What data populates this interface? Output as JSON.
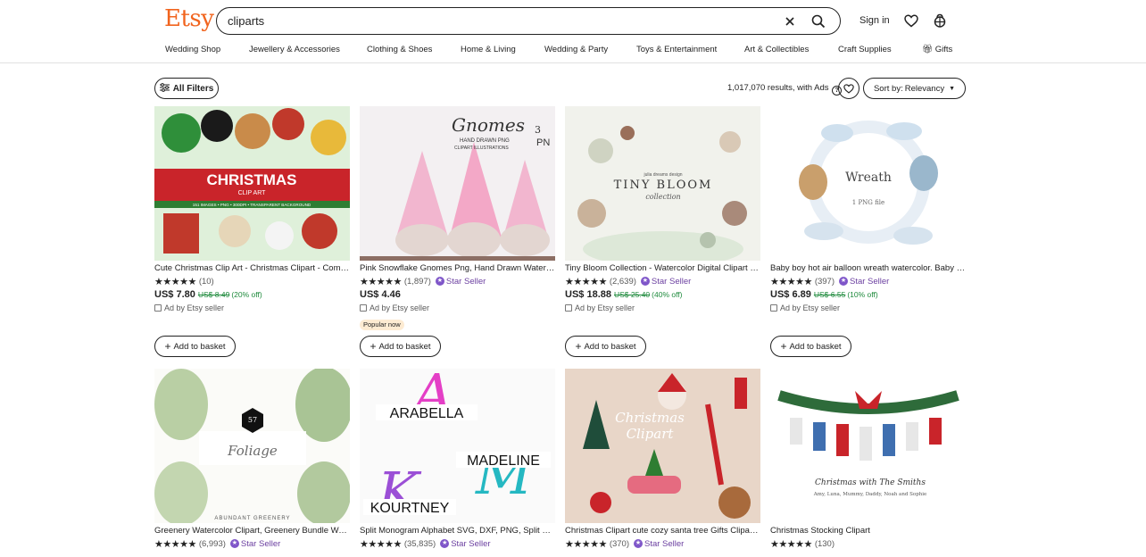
{
  "header": {
    "logo": "Etsy",
    "search_value": "cliparts",
    "signin_label": "Sign in",
    "icons": [
      "close-icon",
      "search-icon",
      "heart-icon",
      "basket-icon"
    ]
  },
  "nav": {
    "items": [
      "Wedding Shop",
      "Jewellery & Accessories",
      "Clothing & Shoes",
      "Home & Living",
      "Wedding & Party",
      "Toys & Entertainment",
      "Art & Collectibles",
      "Craft Supplies",
      "Gifts"
    ]
  },
  "toolbar": {
    "filters_label": "All Filters",
    "results_text": "1,017,070 results, with Ads",
    "sort_prefix": "Sort by:",
    "sort_value": "Relevancy"
  },
  "listings": [
    {
      "title": "Cute Christmas Clip Art - Christmas Clipart - Commercial Use - Digital Download",
      "image_text": [
        "CHRISTMAS",
        "CLIP ART",
        "151 IMAGES • PNG • 300DPI • TRANSPARENT BACKGROUND"
      ],
      "reviews": "(10)",
      "star_seller": "",
      "price": "US$ 7.80",
      "was": "US$ 8.49",
      "off": "(20% off)",
      "ad": "Ad by Etsy seller",
      "badge": "",
      "basket_label": "Add to basket"
    },
    {
      "title": "Pink Snowflake Gnomes Png, Hand Drawn Watercolor Gnome Clipart",
      "image_text": [
        "Gnomes",
        "3",
        "HAND DRAWN PNG",
        "CLIPART ILLUSTRATIONS",
        "PN"
      ],
      "reviews": "(1,897)",
      "star_seller": "Star Seller",
      "price": "US$ 4.46",
      "was": "",
      "off": "",
      "ad": "Ad by Etsy seller",
      "badge": "Popular now",
      "basket_label": "Add to basket"
    },
    {
      "title": "Tiny Bloom Collection - Watercolor Digital Clipart Flowers",
      "image_text": [
        "julia dreams design",
        "TINY BLOOM",
        "collection"
      ],
      "reviews": "(2,639)",
      "star_seller": "Star Seller",
      "price": "US$ 18.88",
      "was": "US$ 25.40",
      "off": "(40% off)",
      "ad": "Ad by Etsy seller",
      "badge": "",
      "basket_label": "Add to basket"
    },
    {
      "title": "Baby boy hot air balloon wreath watercolor. Baby shower clipart",
      "image_text": [
        "Wreath",
        "1 PNG file"
      ],
      "reviews": "(397)",
      "star_seller": "Star Seller",
      "price": "US$ 6.89",
      "was": "US$ 6.55",
      "off": "(10% off)",
      "ad": "Ad by Etsy seller",
      "badge": "",
      "basket_label": "Add to basket"
    },
    {
      "title": "Greenery Watercolor Clipart, Greenery Bundle Watercolor Leaves",
      "image_text": [
        "57",
        "Foliage",
        "ABUNDANT GREENERY"
      ],
      "reviews": "(6,993)",
      "star_seller": "Star Seller",
      "price": "",
      "was": "",
      "off": "",
      "ad": "",
      "badge": "",
      "basket_label": ""
    },
    {
      "title": "Split Monogram Alphabet SVG, DXF, PNG, Split Monogram Font",
      "image_text": [
        "ARABELLA",
        "MADELINE",
        "KOURTNEY"
      ],
      "reviews": "(35,835)",
      "star_seller": "Star Seller",
      "price": "",
      "was": "",
      "off": "",
      "ad": "",
      "badge": "",
      "basket_label": ""
    },
    {
      "title": "Christmas Clipart cute cozy santa tree Gifts Clipart PNG",
      "image_text": [
        "Christmas",
        "Clipart"
      ],
      "reviews": "(370)",
      "star_seller": "Star Seller",
      "price": "",
      "was": "",
      "off": "",
      "ad": "",
      "badge": "",
      "basket_label": ""
    },
    {
      "title": "Christmas Stocking Clipart",
      "image_text": [
        "Christmas with The Smiths",
        "Amy, Luna, Mummy, Daddy, Noah and Sophie"
      ],
      "reviews": "(130)",
      "star_seller": "",
      "price": "",
      "was": "",
      "off": "",
      "ad": "",
      "badge": "",
      "basket_label": ""
    }
  ],
  "colors": {
    "brand": "#F1641E",
    "discount": "#1E8A3C",
    "star_seller": "#6B3FA0"
  }
}
